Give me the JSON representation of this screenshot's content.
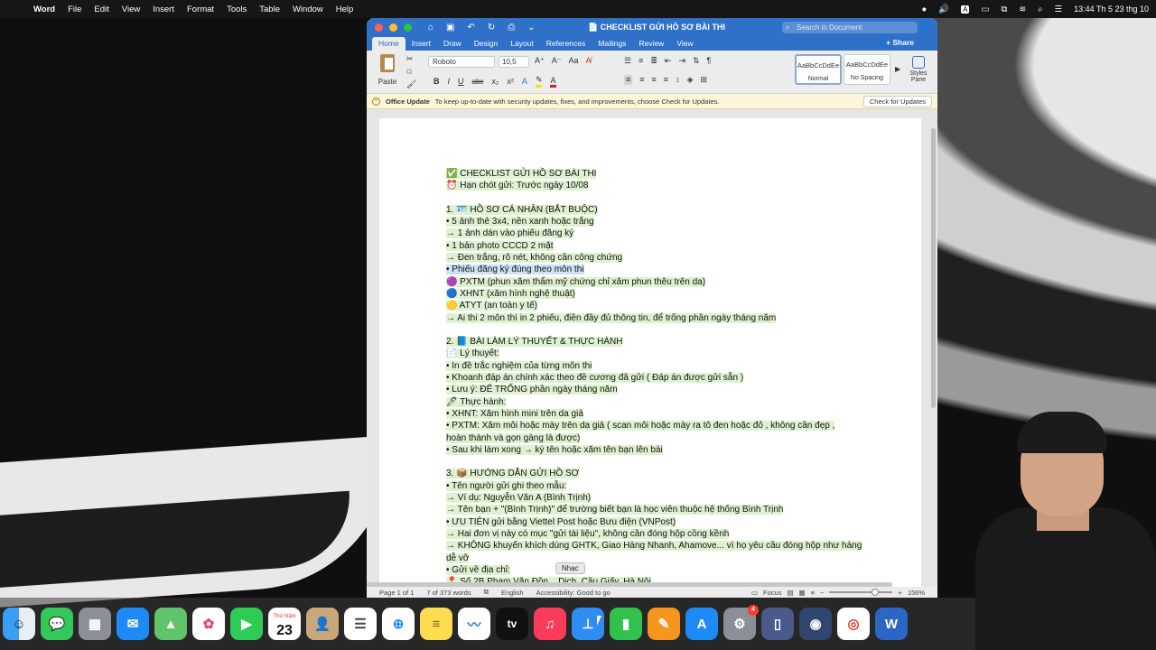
{
  "menubar": {
    "app_name": "Word",
    "items": [
      "File",
      "Edit",
      "View",
      "Insert",
      "Format",
      "Tools",
      "Table",
      "Window",
      "Help"
    ],
    "clock": "13:44 Th 5 23 thg 10"
  },
  "window": {
    "title": "CHECKLIST GỬI HỒ SƠ BÀI THI",
    "search_placeholder": "Search in Document",
    "share_label": "Share",
    "tabs": [
      "Home",
      "Insert",
      "Draw",
      "Design",
      "Layout",
      "References",
      "Mailings",
      "Review",
      "View"
    ],
    "active_tab": "Home"
  },
  "ribbon": {
    "paste_label": "Paste",
    "font_name": "Roboto",
    "font_size": "10,5",
    "styles": [
      {
        "sample": "AaBbCcDdEe",
        "name": "Normal"
      },
      {
        "sample": "AaBbCcDdEe",
        "name": "No Spacing"
      }
    ],
    "styles_pane_label": "Styles Pane"
  },
  "office_update": {
    "title": "Office Update",
    "message": "To keep up-to-date with security updates, fixes, and improvements, choose Check for Updates.",
    "button": "Check for Updates"
  },
  "document": {
    "lines": [
      {
        "text": "✅ CHECKLIST GỬI HỒ SƠ BÀI THI",
        "type": "line"
      },
      {
        "text": "⏰ Hạn chót gửi: Trước ngày 10/08",
        "type": "line"
      },
      {
        "text": "",
        "type": "gap"
      },
      {
        "text": "1. 🪪 HỒ SƠ CÁ NHÂN (BẮT BUỘC)",
        "type": "line"
      },
      {
        "text": "• 5 ảnh thẻ 3x4, nền xanh hoặc trắng",
        "type": "line"
      },
      {
        "text": "→ 1 ảnh dán vào phiếu đăng ký",
        "type": "line"
      },
      {
        "text": "• 1 bản photo CCCD 2 mặt",
        "type": "line"
      },
      {
        "text": "→ Đen trắng, rõ nét, không cần công chứng",
        "type": "line"
      },
      {
        "text": "• Phiếu đăng ký đúng theo môn thi",
        "type": "selected"
      },
      {
        "text": "🟣 PXTM (phun xăm thẩm mỹ chứng chỉ xăm phun thêu trên da)",
        "type": "line"
      },
      {
        "text": "🔵 XHNT (xăm hình nghệ thuật)",
        "type": "line"
      },
      {
        "text": "🟡 ATYT (an toàn y tế)",
        "type": "line"
      },
      {
        "text": "→ Ai thi 2 môn thì in 2 phiếu, điền đầy đủ thông tin, để trống phần ngày tháng năm",
        "type": "line"
      },
      {
        "text": "",
        "type": "gap"
      },
      {
        "text": "2. 📘 BÀI LÀM LÝ THUYẾT & THỰC HÀNH",
        "type": "line"
      },
      {
        "text": "📄 Lý thuyết:",
        "type": "line"
      },
      {
        "text": "• In đề trắc nghiệm của từng môn thi",
        "type": "line"
      },
      {
        "text": "• Khoanh đáp án chính xác theo đề cương đã gửi ( Đáp án được gửi sẵn )",
        "type": "line"
      },
      {
        "text": "• Lưu ý: ĐỂ TRỐNG phần ngày tháng năm",
        "type": "line"
      },
      {
        "text": "🖊 Thực hành:",
        "type": "line"
      },
      {
        "text": "• XHNT: Xăm hình mini trên da giả",
        "type": "line"
      },
      {
        "text": "• PXTM: Xăm môi hoặc mày trên da giả ( scan môi hoặc mày ra tô đen hoặc đỏ , không cần đẹp ,",
        "type": "line"
      },
      {
        "text": "hoàn thành và gọn gàng là được)",
        "type": "line"
      },
      {
        "text": "• Sau khi làm xong → ký tên hoặc xăm tên bạn lên bài",
        "type": "line"
      },
      {
        "text": "",
        "type": "gap"
      },
      {
        "text": "3. 📦 HƯỚNG DẪN GỬI HỒ SƠ",
        "type": "line"
      },
      {
        "text": "• Tên người gửi ghi theo mẫu:",
        "type": "line"
      },
      {
        "text": "→ Ví dụ: Nguyễn Văn A (Bình Trịnh)",
        "type": "line"
      },
      {
        "text": "→ Tên bạn + \"(Bình Trịnh)\" để trường biết bạn là học viên thuộc hệ thống Bình Trịnh",
        "type": "line"
      },
      {
        "text": "• ƯU TIÊN gửi bằng Viettel Post hoặc Bưu điện (VNPost)",
        "type": "line"
      },
      {
        "text": "→ Hai đơn vị này có mục \"gửi tài liệu\", không cần đóng hộp cồng kềnh",
        "type": "line"
      },
      {
        "text": "→ KHÔNG khuyến khích dùng GHTK, Giao Hàng Nhanh, Ahamove... vì họ yêu cầu đóng hộp như hàng",
        "type": "line"
      },
      {
        "text": "dễ vỡ",
        "type": "line"
      },
      {
        "text": "• Gửi về địa chỉ:",
        "type": "line"
      },
      {
        "text": "📍 Số 2B Phạm Văn Đồn... Dịch, Cầu Giấy, Hà Nội",
        "type": "line"
      }
    ]
  },
  "statusbar": {
    "page": "Page 1 of 1",
    "words": "7 of 373 words",
    "language": "English",
    "accessibility": "Accessibility: Good to go",
    "focus": "Focus",
    "zoom": "156%"
  },
  "tooltip": "Nhạc",
  "dock": {
    "calendar_day": "Thứ Năm",
    "calendar_date": "23",
    "settings_badge": "4",
    "tv_label": "tv"
  }
}
